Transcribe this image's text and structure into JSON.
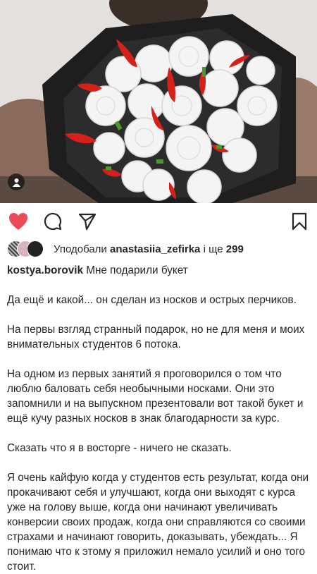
{
  "post": {
    "liked_by_prefix": "Уподобали",
    "liked_by_user": "anastasiia_zefirka",
    "liked_by_suffix": "і ще",
    "liked_by_count": "299",
    "author": "kostya.borovik",
    "caption_first_line": "Мне подарили букет",
    "paragraphs": [
      "Да ещё и какой... он сделан из носков и острых перчиков.",
      "На первы взгляд странный подарок, но не для меня и моих внимательных студентов 6 потока.",
      "На одном из первых занятий я проговорился о том что люблю баловать себя необычными носками. Они это запомнили и на выпускном презентовали вот такой букет и ещё кучу разных носков в знак благодарности за курс.",
      "Сказать что я в восторге - ничего не сказать.",
      "Я очень кайфую когда у студентов есть результат, когда они прокачивают себя и улучшают, когда они выходят с курса уже на голову выше, когда они начинают увеличивать конверсии своих продаж, когда они справляются со своими страхами и начинают говорить, доказывать, убеждать... Я понимаю что к этому я приложил немало усилий и оно того стоит."
    ]
  },
  "colors": {
    "like_red": "#ed4956",
    "text": "#262626"
  },
  "icons": {
    "like": "heart-icon",
    "comment": "comment-icon",
    "share": "send-icon",
    "save": "bookmark-icon",
    "tags": "user-tag-icon"
  }
}
